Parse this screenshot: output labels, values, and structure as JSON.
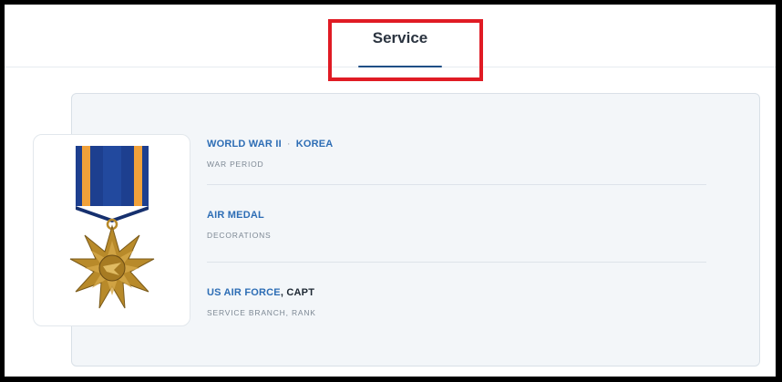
{
  "tabs": {
    "active_label": "Service"
  },
  "service": {
    "war_period": {
      "values": [
        "WORLD WAR II",
        "KOREA"
      ],
      "separator": "·",
      "label": "WAR PERIOD"
    },
    "decorations": {
      "value": "AIR MEDAL",
      "label": "DECORATIONS"
    },
    "branch_rank": {
      "branch": "US AIR FORCE",
      "comma": ",",
      "rank": "CAPT",
      "label": "SERVICE BRANCH, RANK"
    }
  },
  "medal": {
    "icon": "air-medal-icon",
    "ribbon_colors": [
      "#1d3f8f",
      "#f0a13a"
    ],
    "medal_color": "#b88a2a"
  },
  "colors": {
    "highlight": "#e01b24",
    "link": "#2d6db5",
    "active_tab_underline": "#1f4f86"
  }
}
